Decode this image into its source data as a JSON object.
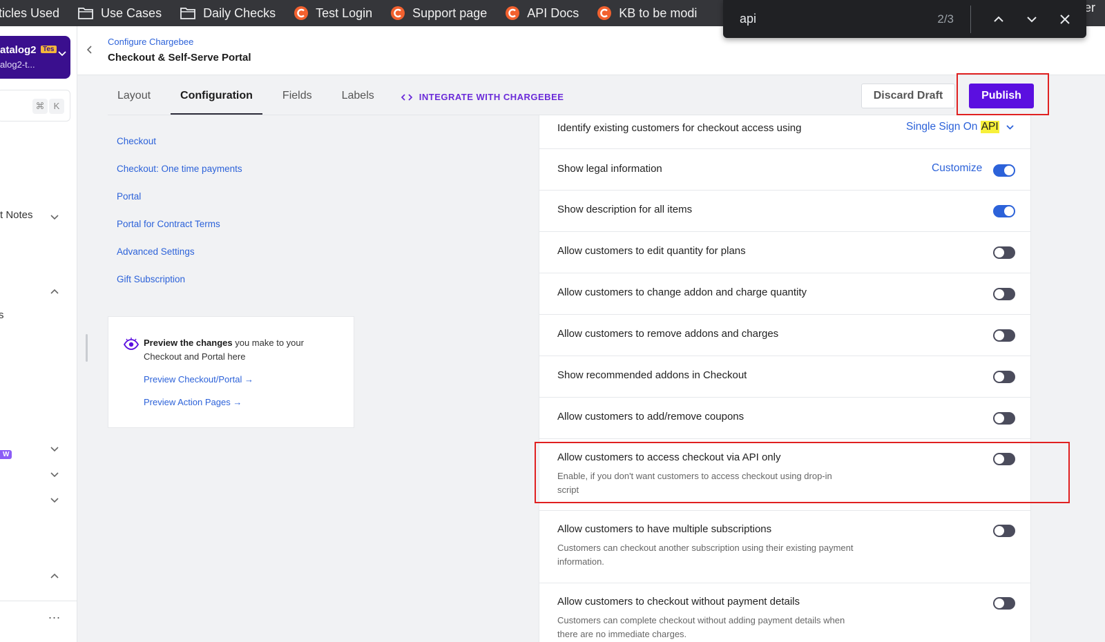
{
  "bookmarks": [
    {
      "label": "ticles Used",
      "icon": "none"
    },
    {
      "label": "Use Cases",
      "icon": "folder-icon"
    },
    {
      "label": "Daily Checks",
      "icon": "folder-icon"
    },
    {
      "label": "Test Login",
      "icon": "chargebee-logo-icon"
    },
    {
      "label": "Support page",
      "icon": "chargebee-logo-icon"
    },
    {
      "label": "API Docs",
      "icon": "chargebee-logo-icon"
    },
    {
      "label": "KB to be modi",
      "icon": "chargebee-logo-icon"
    }
  ],
  "bookmarks_tail": "er",
  "find": {
    "query": "api",
    "count": "2/3"
  },
  "nav": {
    "site_name": "atalog2",
    "site_badge": "Tes",
    "site_sub": "alog2-t...",
    "search_kbd": [
      "⌘",
      "K"
    ],
    "item_notes": "t Notes",
    "item_s": "s",
    "new_badge": "W",
    "more": "..."
  },
  "header": {
    "breadcrumb": "Configure Chargebee",
    "title": "Checkout & Self-Serve Portal"
  },
  "tabs": [
    {
      "label": "Layout",
      "active": false
    },
    {
      "label": "Configuration",
      "active": true
    },
    {
      "label": "Fields",
      "active": false
    },
    {
      "label": "Labels",
      "active": false
    }
  ],
  "integrate_label": "INTEGRATE WITH CHARGEBEE",
  "actions": {
    "discard": "Discard Draft",
    "publish": "Publish"
  },
  "sections": [
    "Checkout",
    "Checkout: One time payments",
    "Portal",
    "Portal for Contract Terms",
    "Advanced Settings",
    "Gift Subscription"
  ],
  "preview": {
    "bold": "Preview the changes",
    "rest": " you make to your Checkout and Portal here",
    "link1": "Preview Checkout/Portal →",
    "link2": "Preview Action Pages →"
  },
  "settings": {
    "identify": {
      "label": "Identify existing customers for checkout access using",
      "value_prefix": "Single Sign On ",
      "value_highlight": "API"
    },
    "legal": {
      "label": "Show legal information",
      "link": "Customize",
      "on": true
    },
    "description": {
      "label": "Show description for all items",
      "on": true
    },
    "edit_qty": {
      "label": "Allow customers to edit quantity for plans",
      "on": false
    },
    "addon_qty": {
      "label": "Allow customers to change addon and charge quantity",
      "on": false
    },
    "remove_addons": {
      "label": "Allow customers to remove addons and charges",
      "on": false
    },
    "recommended": {
      "label": "Show recommended addons in Checkout",
      "on": false
    },
    "coupons": {
      "label": "Allow customers to add/remove coupons",
      "on": false
    },
    "api_only": {
      "label": "Allow customers to access checkout via API only",
      "desc": "Enable, if you don't want customers to access checkout using drop-in script",
      "on": false
    },
    "multi_subs": {
      "label": "Allow customers to have multiple subscriptions",
      "desc": "Customers can checkout another subscription using their existing payment information.",
      "on": false
    },
    "no_payment": {
      "label": "Allow customers to checkout without payment details",
      "desc": "Customers can complete checkout without adding payment details when there are no immediate charges.",
      "on": false
    }
  },
  "colors": {
    "accent": "#5b0fe0",
    "link": "#2c62d9",
    "toggle_on": "#2c62d9",
    "toggle_off": "#4b4c5c",
    "highlight": "#f7f03a",
    "annotation": "#e02020"
  }
}
